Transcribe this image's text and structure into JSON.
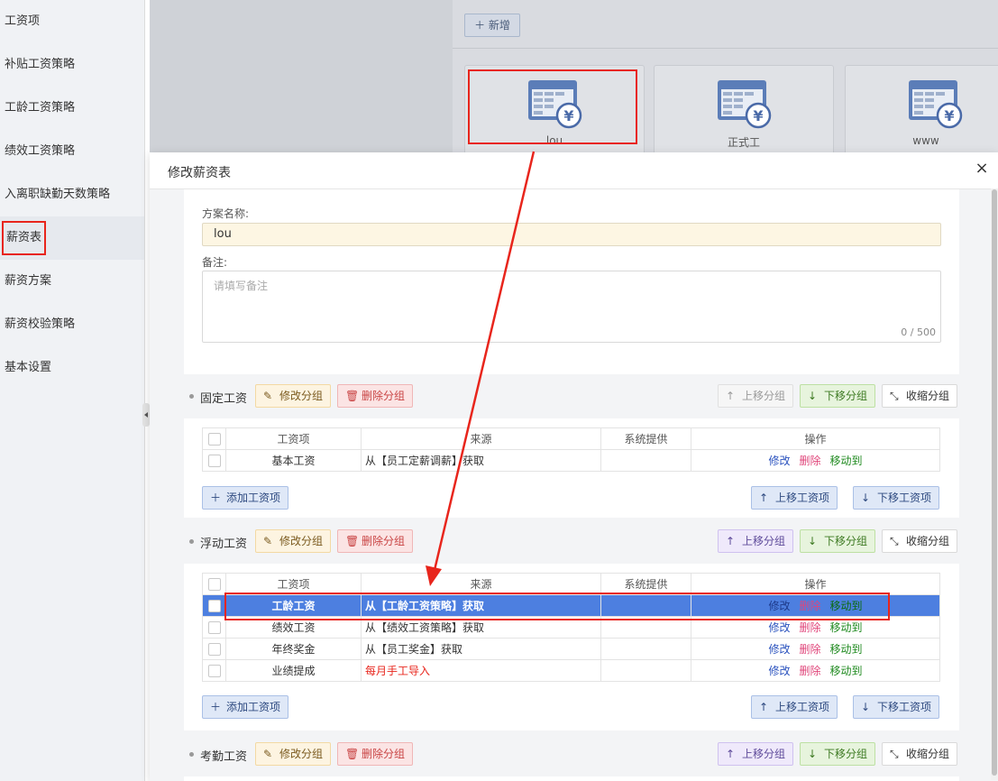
{
  "sidebar": {
    "items": [
      {
        "label": "工资项"
      },
      {
        "label": "补贴工资策略"
      },
      {
        "label": "工龄工资策略"
      },
      {
        "label": "绩效工资策略"
      },
      {
        "label": "入离职缺勤天数策略"
      },
      {
        "label": "薪资表"
      },
      {
        "label": "薪资方案"
      },
      {
        "label": "薪资校验策略"
      },
      {
        "label": "基本设置"
      }
    ],
    "active_index": 5
  },
  "background": {
    "add_button": "新增",
    "cards": [
      {
        "label": "lou"
      },
      {
        "label": "正式工"
      },
      {
        "label": "www"
      }
    ]
  },
  "modal": {
    "title": "修改薪资表",
    "close": "×",
    "form": {
      "name_label": "方案名称:",
      "name_value": "lou",
      "note_label": "备注:",
      "note_placeholder": "请填写备注",
      "note_count": "0 / 500"
    },
    "group_buttons": {
      "edit_group": "修改分组",
      "delete_group": "删除分组",
      "move_up": "上移分组",
      "move_down": "下移分组",
      "collapse": "收缩分组"
    },
    "table_headers": {
      "item": "工资项",
      "source": "来源",
      "system": "系统提供",
      "ops": "操作"
    },
    "row_ops": {
      "edit": "修改",
      "delete": "删除",
      "move": "移动到"
    },
    "footer_buttons": {
      "add_item": "添加工资项",
      "move_up_item": "上移工资项",
      "move_down_item": "下移工资项"
    },
    "groups": [
      {
        "title": "固定工资",
        "rows": [
          {
            "item": "基本工资",
            "source": "从【员工定薪调薪】获取",
            "system": ""
          }
        ]
      },
      {
        "title": "浮动工资",
        "rows": [
          {
            "item": "工龄工资",
            "source": "从【工龄工资策略】获取",
            "system": ""
          },
          {
            "item": "绩效工资",
            "source": "从【绩效工资策略】获取",
            "system": ""
          },
          {
            "item": "年终奖金",
            "source": "从【员工奖金】获取",
            "system": ""
          },
          {
            "item": "业绩提成",
            "source": "每月手工导入",
            "system": ""
          }
        ]
      },
      {
        "title": "考勤工资",
        "rows": []
      }
    ]
  },
  "colors": {
    "highlight_row": "#4d7fe0",
    "annotation_red": "#e8251c"
  }
}
